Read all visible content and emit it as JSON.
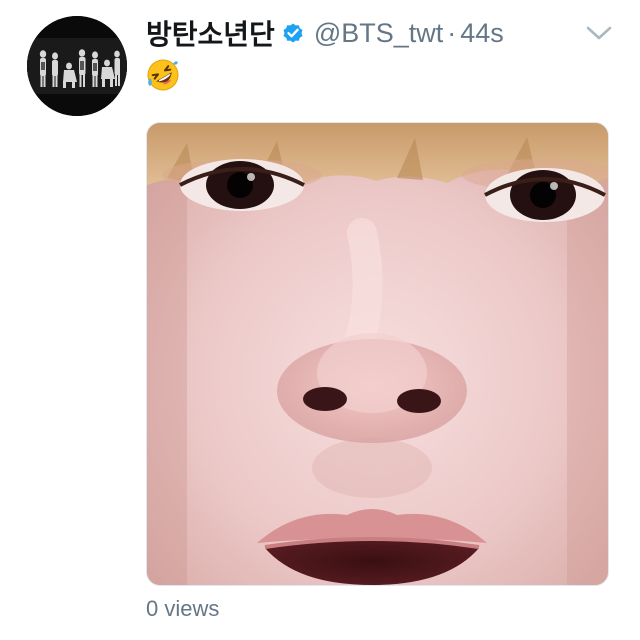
{
  "tweet": {
    "display_name": "방탄소년단",
    "handle": "@BTS_twt",
    "separator": "·",
    "time": "44s",
    "verified": true,
    "body_emoji": "rolling-on-the-floor-laughing",
    "views": "0 views"
  },
  "icons": {
    "verified": "verified-badge-icon",
    "caret": "chevron-down-icon"
  },
  "colors": {
    "verified_blue": "#1da1f2",
    "secondary_text": "#657786",
    "primary_text": "#14171a"
  }
}
